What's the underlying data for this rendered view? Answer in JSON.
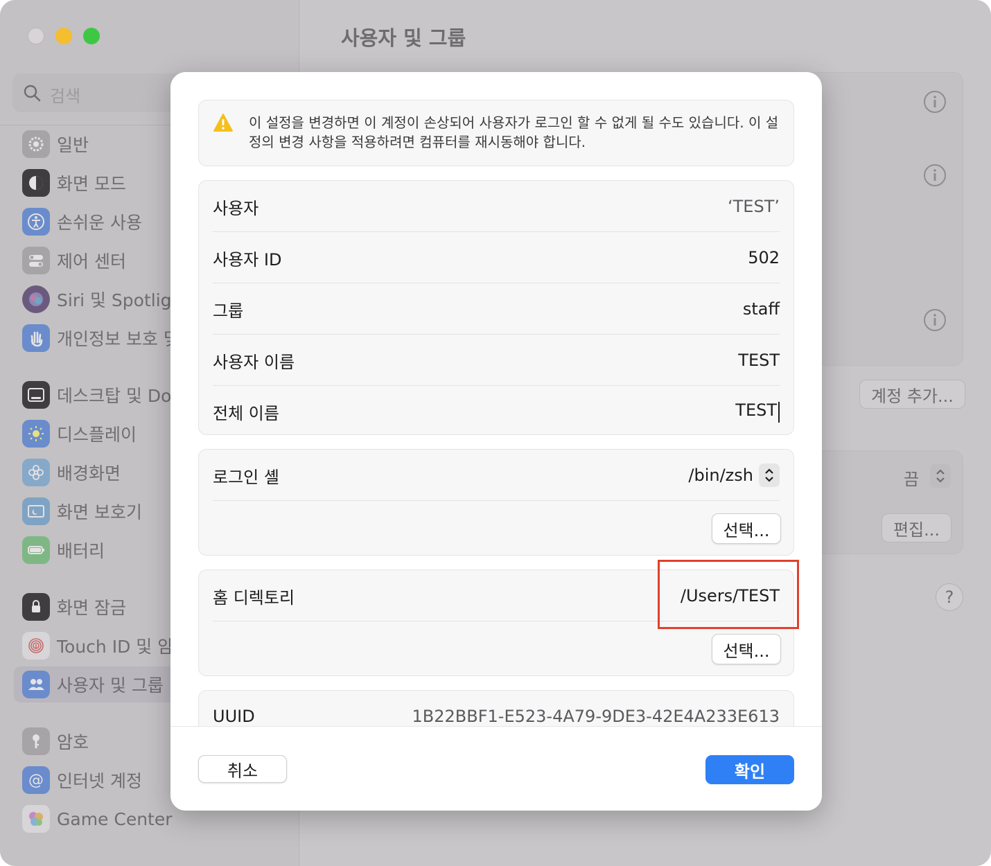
{
  "window": {
    "title": "사용자 및 그룹"
  },
  "search": {
    "placeholder": "검색"
  },
  "sidebar": {
    "items": [
      {
        "label": "일반",
        "color": "#8e8e93"
      },
      {
        "label": "화면 모드",
        "color": "#1c1c1e"
      },
      {
        "label": "손쉬운 사용",
        "color": "#1a73e8"
      },
      {
        "label": "제어 센터",
        "color": "#8e8e93"
      },
      {
        "label": "Siri 및 Spotlight",
        "color": "#7b4fc9"
      },
      {
        "label": "개인정보 보호 및 보안",
        "color": "#2f6fe0"
      },
      {
        "label": "데스크탑 및 Dock",
        "color": "#1c1c1e"
      },
      {
        "label": "디스플레이",
        "color": "#2f80f5"
      },
      {
        "label": "배경화면",
        "color": "#3ab0e8"
      },
      {
        "label": "화면 보호기",
        "color": "#3aa0d8"
      },
      {
        "label": "배터리",
        "color": "#34c759"
      },
      {
        "label": "화면 잠금",
        "color": "#1c1c1e"
      },
      {
        "label": "Touch ID 및 암호",
        "color": "#f2f2f2"
      },
      {
        "label": "사용자 및 그룹",
        "color": "#2f80f5"
      },
      {
        "label": "암호",
        "color": "#8e8e93"
      },
      {
        "label": "인터넷 계정",
        "color": "#2f80f5"
      },
      {
        "label": "Game Center",
        "color": "#f2f2f2"
      }
    ]
  },
  "background": {
    "add_account_button": "계정 추가...",
    "off_label": "끔",
    "edit_button": "편집...",
    "help_label": "?"
  },
  "dialog": {
    "warning": "이 설정을 변경하면 이 계정이 손상되어 사용자가 로그인 할 수 없게 될 수도 있습니다. 이 설정의 변경 사항을 적용하려면 컴퓨터를 재시동해야 합니다.",
    "user_label": "사용자",
    "user_value": "‘TEST’",
    "uid_label": "사용자 ID",
    "uid_value": "502",
    "group_label": "그룹",
    "group_value": "staff",
    "account_label": "사용자 이름",
    "account_value": "TEST",
    "fullname_label": "전체 이름",
    "fullname_value": "TEST",
    "shell_label": "로그인 셸",
    "shell_value": "/bin/zsh",
    "shell_choose": "선택...",
    "home_label": "홈 디렉토리",
    "home_value": "/Users/TEST",
    "home_choose": "선택...",
    "uuid_label": "UUID",
    "uuid_value": "1B22BBF1-E523-4A79-9DE3-42E4A233E613",
    "cancel": "취소",
    "ok": "확인"
  }
}
